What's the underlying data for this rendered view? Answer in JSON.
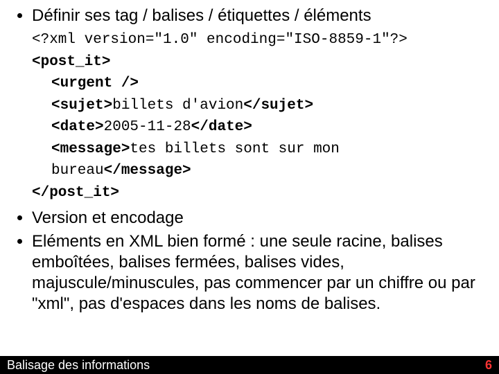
{
  "bullets": {
    "b1": "Définir ses tag / balises / étiquettes / éléments",
    "b2": "Version et encodage",
    "b3": "Eléments en XML bien formé : une seule racine, balises emboîtées, balises fermées, balises vides, majuscule/minuscules, pas commencer par un chiffre ou par \"xml\", pas d'espaces dans les noms de balises."
  },
  "code": {
    "xml_decl": "<?xml version=\"1.0\" encoding=\"ISO-8859-1\"?>",
    "post_it_open": "<post_it>",
    "urgent": "<urgent />",
    "sujet_open": "<sujet>",
    "sujet_text": "billets d'avion",
    "sujet_close": "</sujet>",
    "date_open": "<date>",
    "date_text": "2005-11-28",
    "date_close": "</date>",
    "message_open": "<message>",
    "message_text": "tes billets sont sur mon bureau",
    "message_close": "</message>",
    "post_it_close": "</post_it>"
  },
  "footer": {
    "left": "Balisage des informations",
    "right": "6"
  }
}
